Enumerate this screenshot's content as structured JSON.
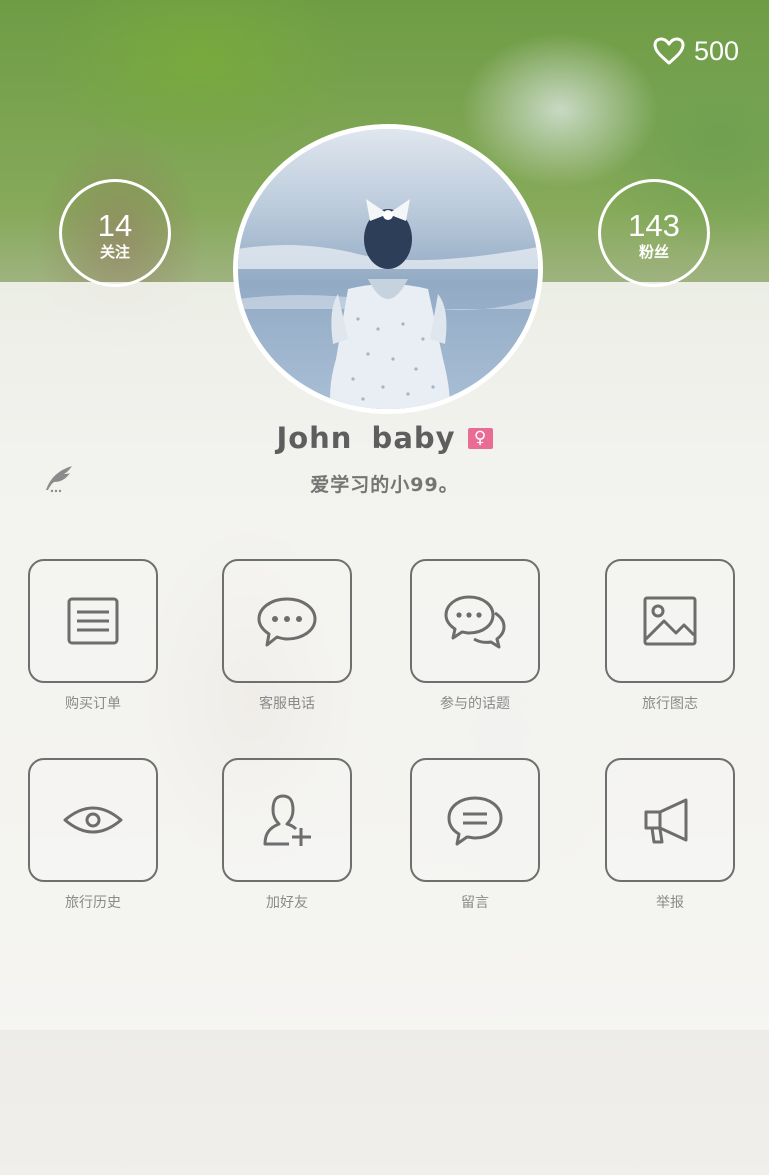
{
  "likes": {
    "icon": "heart-outline-icon",
    "count": "500"
  },
  "stats": {
    "following": {
      "count": "14",
      "label": "关注"
    },
    "followers": {
      "count": "143",
      "label": "粉丝"
    }
  },
  "profile": {
    "name": "John  baby",
    "gender_symbol": "♀",
    "gender_color": "#e96c95",
    "bio": "爱学习的小99。",
    "edit_icon": "quill-pen-icon"
  },
  "menu": [
    {
      "label": "购买订单",
      "icon": "order-list-icon"
    },
    {
      "label": "客服电话",
      "icon": "chat-bubble-icon"
    },
    {
      "label": "参与的话题",
      "icon": "conversation-icon"
    },
    {
      "label": "旅行图志",
      "icon": "image-icon"
    },
    {
      "label": "旅行历史",
      "icon": "eye-icon"
    },
    {
      "label": "加好友",
      "icon": "add-friend-icon"
    },
    {
      "label": "留言",
      "icon": "message-icon"
    },
    {
      "label": "举报",
      "icon": "megaphone-icon"
    }
  ]
}
